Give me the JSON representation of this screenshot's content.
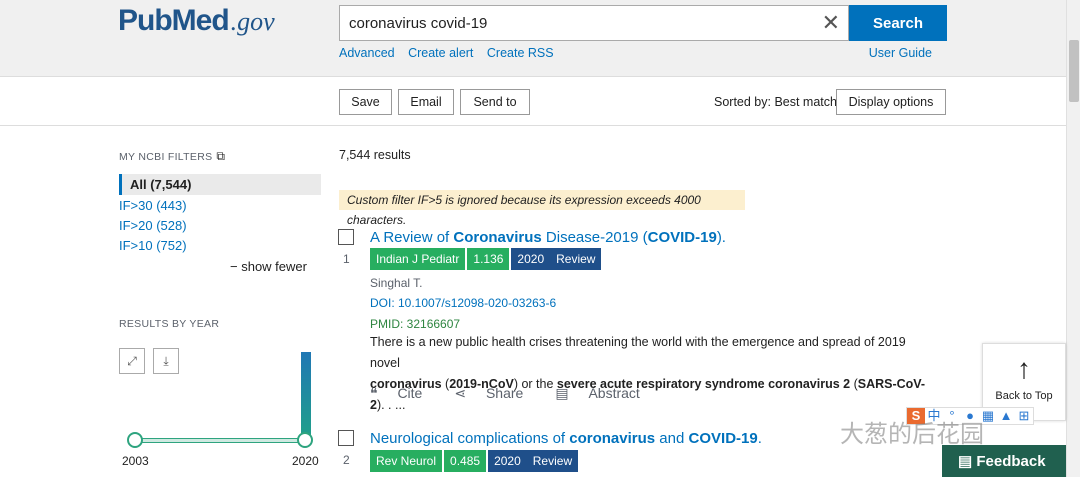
{
  "header": {
    "logo_main": "Pub",
    "logo_main2": "Med",
    "logo_suffix": ".gov",
    "search_value": "coronavirus covid-19",
    "search_button": "Search",
    "links": [
      "Advanced",
      "Create alert",
      "Create RSS"
    ],
    "user_guide": "User Guide"
  },
  "toolbar": {
    "save": "Save",
    "email": "Email",
    "send_to": "Send to",
    "sorted_by": "Sorted by: Best match",
    "display_options": "Display options"
  },
  "sidebar": {
    "filters_title": "MY NCBI FILTERS",
    "filters": [
      {
        "label": "All (7,544)",
        "active": true
      },
      {
        "label": "IF>30 (443)"
      },
      {
        "label": "IF>20 (528)"
      },
      {
        "label": "IF>10 (752)"
      }
    ],
    "show_fewer": "show fewer",
    "results_by_year_title": "RESULTS BY YEAR",
    "year_start": "2003",
    "year_end": "2020"
  },
  "results": {
    "count": "7,544 results",
    "notice": "Custom filter IF>5 is ignored because its expression exceeds 4000 characters.",
    "items": [
      {
        "number": "1",
        "title_parts": [
          "A Review of ",
          "Coronavirus",
          " Disease-2019 (",
          "COVID-19",
          ")."
        ],
        "journal": "Indian J Pediatr",
        "impact": "1.136",
        "year": "2020",
        "type": "Review",
        "authors": "Singhal T.",
        "doi": "DOI: 10.1007/s12098-020-03263-6",
        "pmid": "PMID: 32166607",
        "snippet_line1": "There is a new public health crises threatening the world with the emergence and spread of 2019 novel",
        "snippet_line2_parts": [
          "coronavirus",
          " (",
          "2019-nCoV",
          ") or the ",
          "severe acute respiratory syndrome coronavirus 2",
          " (",
          "SARS-CoV-2",
          "). . ..."
        ]
      },
      {
        "number": "2",
        "title_parts": [
          "Neurological complications of ",
          "coronavirus",
          " and ",
          "COVID-19",
          "."
        ],
        "journal": "Rev Neurol",
        "impact": "0.485",
        "year": "2020",
        "type": "Review"
      }
    ],
    "actions": {
      "cite": "Cite",
      "share": "Share",
      "abstract": "Abstract"
    }
  },
  "back_to_top": "Back to Top",
  "feedback": "Feedback",
  "watermark": "大葱的后花园",
  "ime": {
    "s": "S",
    "lang": "中"
  },
  "colors": {
    "brand_blue": "#0071bc",
    "badge_green": "#27ae60",
    "badge_blue": "#1f4f8a",
    "feedback_bg": "#20604f"
  }
}
